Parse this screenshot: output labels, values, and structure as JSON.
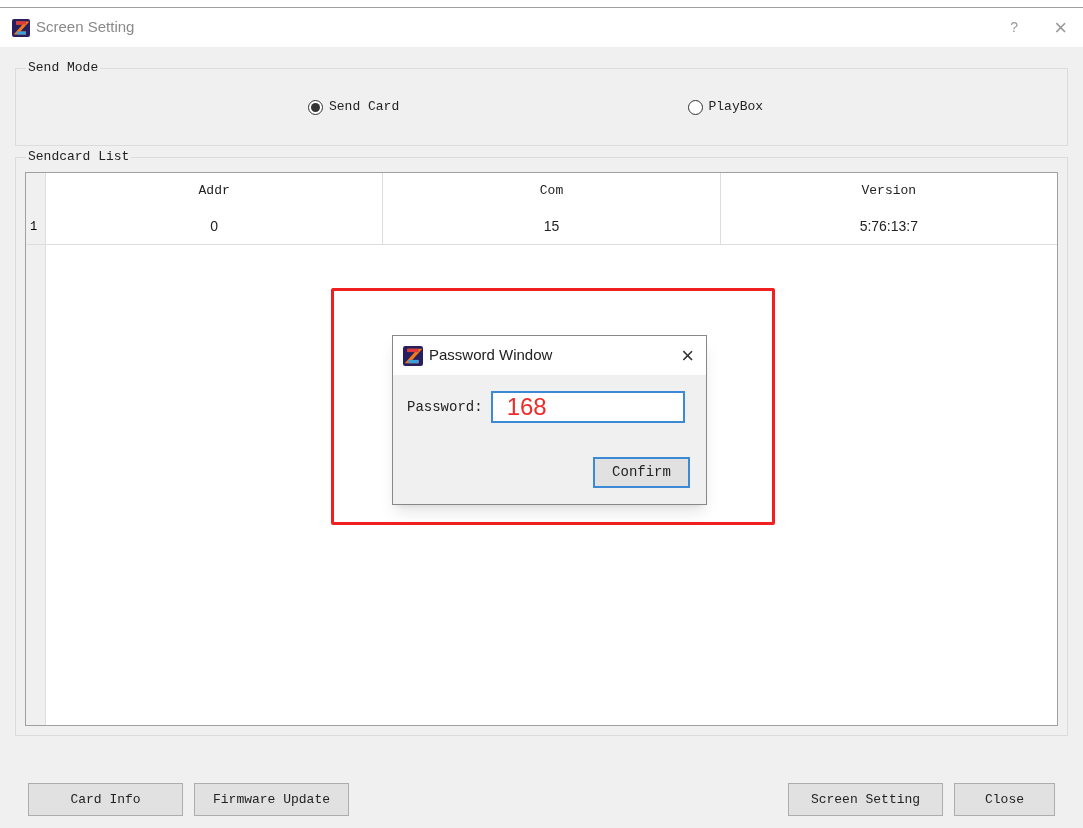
{
  "window": {
    "title": "Screen Setting",
    "help": "?",
    "close": "×"
  },
  "send_mode": {
    "title": "Send Mode",
    "options": [
      {
        "label": "Send Card",
        "selected": true
      },
      {
        "label": "PlayBox",
        "selected": false
      }
    ]
  },
  "sendcard_list": {
    "title": "Sendcard List",
    "columns": [
      "Addr",
      "Com",
      "Version"
    ],
    "rows": [
      {
        "number": "1",
        "cells": [
          "0",
          "15",
          "5:76:13:7"
        ]
      }
    ]
  },
  "password_dialog": {
    "title": "Password Window",
    "close": "×",
    "label": "Password:",
    "value": "168",
    "button": "Confirm"
  },
  "buttons_left": [
    "Card Info",
    "Firmware Update"
  ],
  "buttons_right": [
    "Screen Setting",
    "Close"
  ]
}
